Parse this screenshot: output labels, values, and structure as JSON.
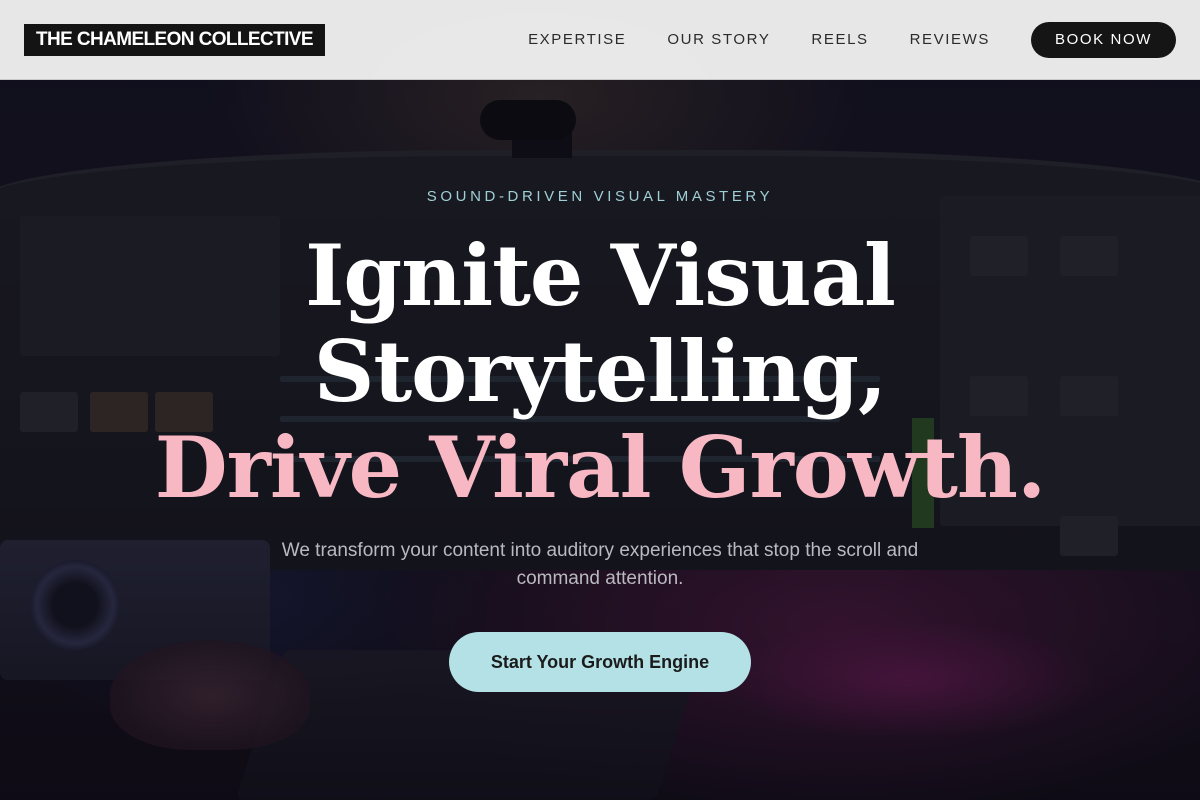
{
  "header": {
    "logo_text": "THE CHAMELEON COLLECTIVE",
    "nav": [
      {
        "label": "EXPERTISE"
      },
      {
        "label": "OUR STORY"
      },
      {
        "label": "REELS"
      },
      {
        "label": "REVIEWS"
      }
    ],
    "cta_label": "BOOK NOW"
  },
  "hero": {
    "eyebrow": "SOUND-DRIVEN VISUAL MASTERY",
    "headline": {
      "line1": "Ignite Visual",
      "line2": "Storytelling,",
      "line3": "Drive Viral Growth."
    },
    "subtext": "We transform your content into auditory experiences that stop the scroll and command attention.",
    "cta_label": "Start Your Growth Engine"
  },
  "colors": {
    "header_bg": "#f0f0f0",
    "logo_bg": "#141414",
    "eyebrow": "#9fcfd6",
    "headline_white": "#ffffff",
    "headline_pink": "#f7b8c4",
    "cta_bg": "#b4e1e6",
    "book_bg": "#151515"
  }
}
